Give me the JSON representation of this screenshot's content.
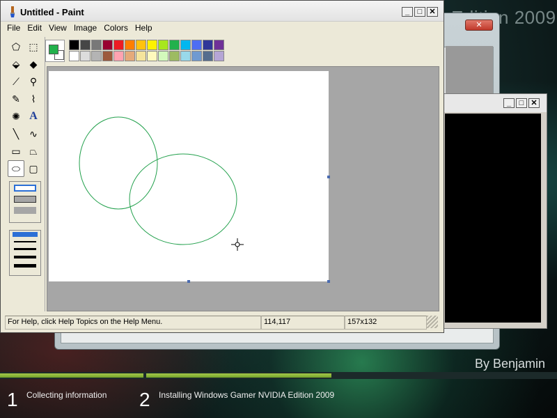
{
  "desktop": {
    "edition_title": "Edition 2009",
    "author": "By Benjamin"
  },
  "paint": {
    "title": "Untitled - Paint",
    "menu": [
      "File",
      "Edit",
      "View",
      "Image",
      "Colors",
      "Help"
    ],
    "title_buttons": {
      "minimize": "_",
      "maximize": "□",
      "close": "✕"
    },
    "tools": [
      {
        "name": "free-form-select-icon",
        "glyph": "⬠"
      },
      {
        "name": "select-icon",
        "glyph": "⬚"
      },
      {
        "name": "eraser-icon",
        "glyph": "⬙"
      },
      {
        "name": "fill-bucket-icon",
        "glyph": "◆"
      },
      {
        "name": "color-picker-icon",
        "glyph": "⟋"
      },
      {
        "name": "magnifier-icon",
        "glyph": "⚲"
      },
      {
        "name": "pencil-icon",
        "glyph": "✎"
      },
      {
        "name": "brush-icon",
        "glyph": "⌇"
      },
      {
        "name": "airbrush-icon",
        "glyph": "✺"
      },
      {
        "name": "text-icon",
        "glyph": "A"
      },
      {
        "name": "line-icon",
        "glyph": "╲"
      },
      {
        "name": "curve-icon",
        "glyph": "∿"
      },
      {
        "name": "rectangle-icon",
        "glyph": "▭"
      },
      {
        "name": "polygon-icon",
        "glyph": "⏢"
      },
      {
        "name": "ellipse-icon",
        "glyph": "⬭"
      },
      {
        "name": "rounded-rectangle-icon",
        "glyph": "▢"
      }
    ],
    "active_tool": "ellipse-icon",
    "foreground_color": "#22b14c",
    "background_color": "#ffffff",
    "palette_row1": [
      "#000000",
      "#464646",
      "#787878",
      "#990030",
      "#ed1c24",
      "#ff7e00",
      "#ffc20e",
      "#fff200",
      "#a8e61d",
      "#22b14c",
      "#00b7ef",
      "#4d6df3",
      "#2f3699",
      "#6f3198"
    ],
    "palette_row2": [
      "#ffffff",
      "#dcdcdc",
      "#b4b4b4",
      "#9c5a3c",
      "#ffa3b1",
      "#e5aa7a",
      "#f5e49c",
      "#fff9bd",
      "#d3f9bc",
      "#9dbb61",
      "#99d9ea",
      "#709ad1",
      "#546d8e",
      "#b5a5d5"
    ],
    "status": {
      "help": "For Help, click Help Topics on the Help Menu.",
      "position": "114,117",
      "size": "157x132"
    },
    "shape_color": "#22a04c"
  },
  "cmd": {
    "buttons": {
      "minimize": "_",
      "maximize": "□",
      "close": "✕"
    }
  },
  "setup": {
    "close": "✕",
    "progress_step1": 1.0,
    "progress_step2": 0.45,
    "steps": [
      {
        "number": "1",
        "label": "Collecting information"
      },
      {
        "number": "2",
        "label": "Installing Windows Gamer NVIDIA Edition 2009"
      }
    ]
  }
}
